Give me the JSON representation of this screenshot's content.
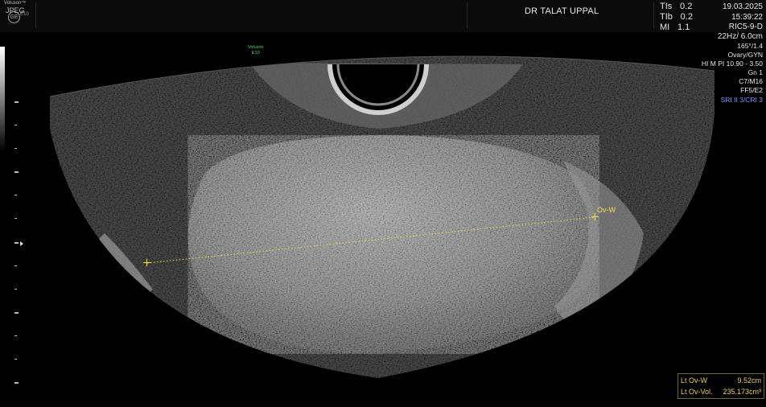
{
  "header": {
    "brand": "Voluson™",
    "format": "JPEG",
    "logo": "GE",
    "model": "E10",
    "clinic": "DR TALAT UPPAL",
    "params": [
      {
        "label": "TIs",
        "value": "0.2"
      },
      {
        "label": "TIb",
        "value": "0.2"
      },
      {
        "label": "MI",
        "value": "1.1"
      }
    ],
    "date": "19.03.2025",
    "time": "15:39:22"
  },
  "probe": {
    "name": "RIC5-9-D",
    "freq_depth": "22Hz/ 6.0cm",
    "angle": "165°/1.4",
    "preset": "Ovary/GYN",
    "harmonic": "HI M PI 10.90 - 3.50",
    "gain": "Gn  1",
    "map": "C7/M16",
    "frame": "FF5/E2",
    "sri": "SRI II 3/CRI 3"
  },
  "image_tag": {
    "line1": "Voluson",
    "line2": "E10"
  },
  "caliper": {
    "label": "Ov-W"
  },
  "measurements": [
    {
      "label": "Lt Ov-W",
      "value": "9.52cm"
    },
    {
      "label": "Lt Ov-Vol.",
      "value": "235.173cm³"
    }
  ],
  "colors": {
    "caliper": "#f3e24a",
    "sri": "#8a8aff",
    "tag": "#4cd964"
  }
}
